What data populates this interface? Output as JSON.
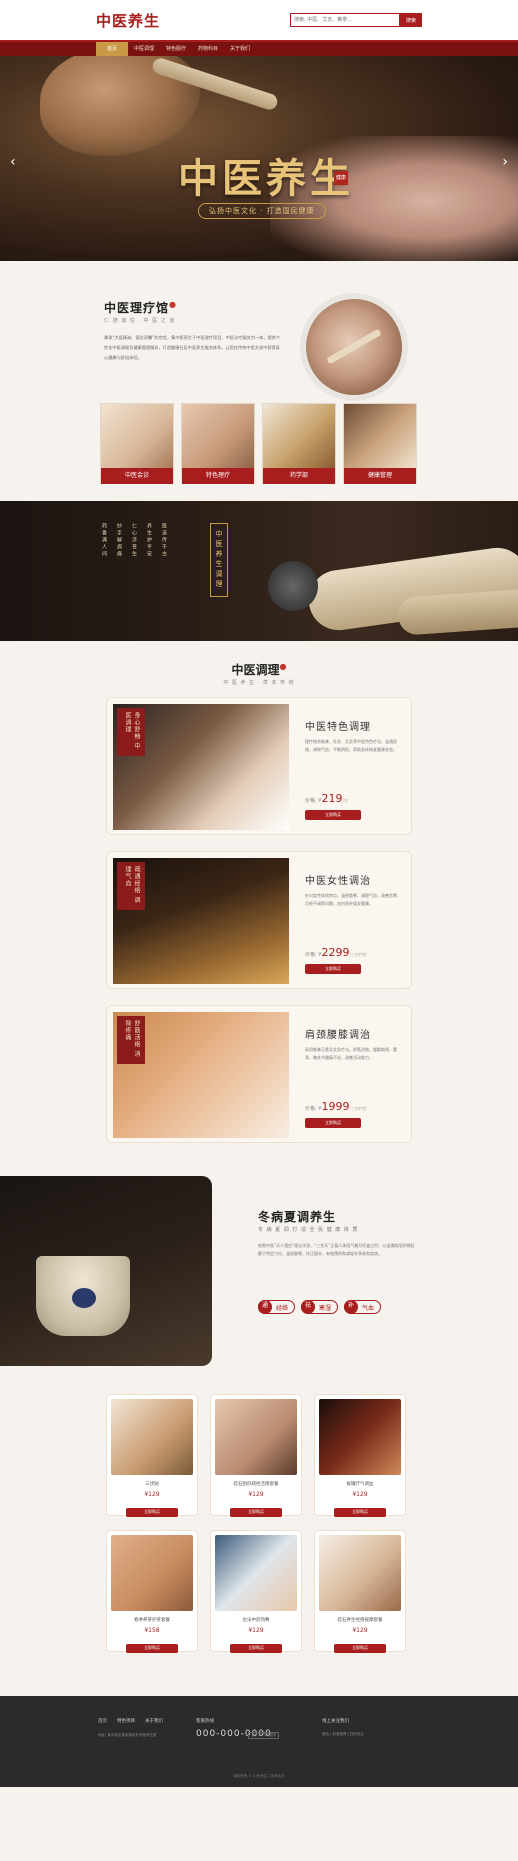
{
  "header": {
    "logo": "中医养生",
    "search_placeholder": "搜索: 中医、艾灸、推拿...",
    "search_button": "搜索"
  },
  "nav": [
    "首页",
    "中医调理",
    "特色服疗",
    "药物科目",
    "关于我们"
  ],
  "banner": {
    "title": "中医养生",
    "seal": "健康",
    "subtitle": "弘扬中医文化 · 打造国民健康"
  },
  "about": {
    "title": "中医理疗馆",
    "tag": "仁 德 诚 信 · 中 医 之 道",
    "desc": "秉承“大医精诚、德艺双馨”的宗旨，集中医养生于中医理疗项目、中医诊疗服务为一体，提供个性化中医调理及健康管理服务，打造健康社区中医养生服务体系，让您在传统中医文化中获得身心健康与舒适体验。",
    "cards": [
      "中医会诊",
      "特色理疗",
      "药学部",
      "健康管理"
    ]
  },
  "culture": {
    "vtitle": "中医养生调理",
    "poem": [
      "医道传千古",
      "养生护平安",
      "仁心济苍生",
      "妙手解病痛",
      "药香满人间"
    ]
  },
  "therapy": {
    "title": "中医调理",
    "tag": "中 医 养 生 · 草 本 传 统",
    "items": [
      {
        "label": "身心舒畅 中医调理",
        "name": "中医特色调理",
        "text": "理疗结合推拿、针灸、艾灸等中医特色疗法，温通经络，调和气血，平衡阴阳，帮助身体恢复健康状态。",
        "price": "219",
        "unit": "/次",
        "buy": "立即购买"
      },
      {
        "label": "疏通经络 调理气血",
        "name": "中医女性调治",
        "text": "针对女性体质特点，温经散寒、调理气血，改善宫寒、月经不调等问题，由内而外焕发健康。",
        "price": "2299",
        "unit": "/三次疗程",
        "buy": "立即购买"
      },
      {
        "label": "舒筋活络 消除疼痛",
        "name": "肩颈腰膝调治",
        "text": "采用推拿正骨及艾灸疗法，舒筋活络，缓解肩颈、腰背、膝关节酸痛不适，改善活动能力。",
        "price": "1999",
        "unit": "/三次疗程",
        "buy": "立即购买"
      }
    ]
  },
  "season": {
    "title": "冬病夏调养生",
    "tag": "冬 病 夏 调 打 造 全 民 健 康 体 质",
    "desc": "依照中医“天人相应”理论学说，“三伏天”正值人体阳气最为旺盛之时，以温通助阳药物贴敷于特定穴位，温经散寒、扶正固本，有效预防和减轻冬季易发疾病。",
    "pills": [
      {
        "c": "通",
        "t": "经络"
      },
      {
        "c": "祛",
        "t": "寒湿"
      },
      {
        "c": "补",
        "t": "气血"
      }
    ]
  },
  "products": [
    {
      "name": "三伏贴",
      "price": "¥129",
      "buy": "立即购买"
    },
    {
      "name": "砭石刮痧疏经活络套餐",
      "price": "¥129",
      "buy": "立即购买"
    },
    {
      "name": "拔罐疗气调血",
      "price": "¥129",
      "buy": "立即购买"
    },
    {
      "name": "春季养肝护肝套餐",
      "price": "¥158",
      "buy": "立即购买"
    },
    {
      "name": "古法中药热敷",
      "price": "¥129",
      "buy": "立即购买"
    },
    {
      "name": "砭石养生经络按摩套餐",
      "price": "¥129",
      "buy": "立即购买"
    }
  ],
  "footer": {
    "links": [
      "首页",
      "特色项目",
      "关于我们"
    ],
    "address": "地址: 某市某区某街道某号中医养生馆",
    "hotline_label": "客服热线",
    "phone": "000-000-0000",
    "phone_note": "全天24小时服务",
    "follow": "线上关注我们",
    "social": "微信 | 新浪微博 | 扫码关注",
    "copyright": "版权所有 © 中医养生 | 技术支持"
  },
  "colors": {
    "brand": "#a81d1d",
    "gold": "#c99a45",
    "bg": "#f6f3ee"
  }
}
